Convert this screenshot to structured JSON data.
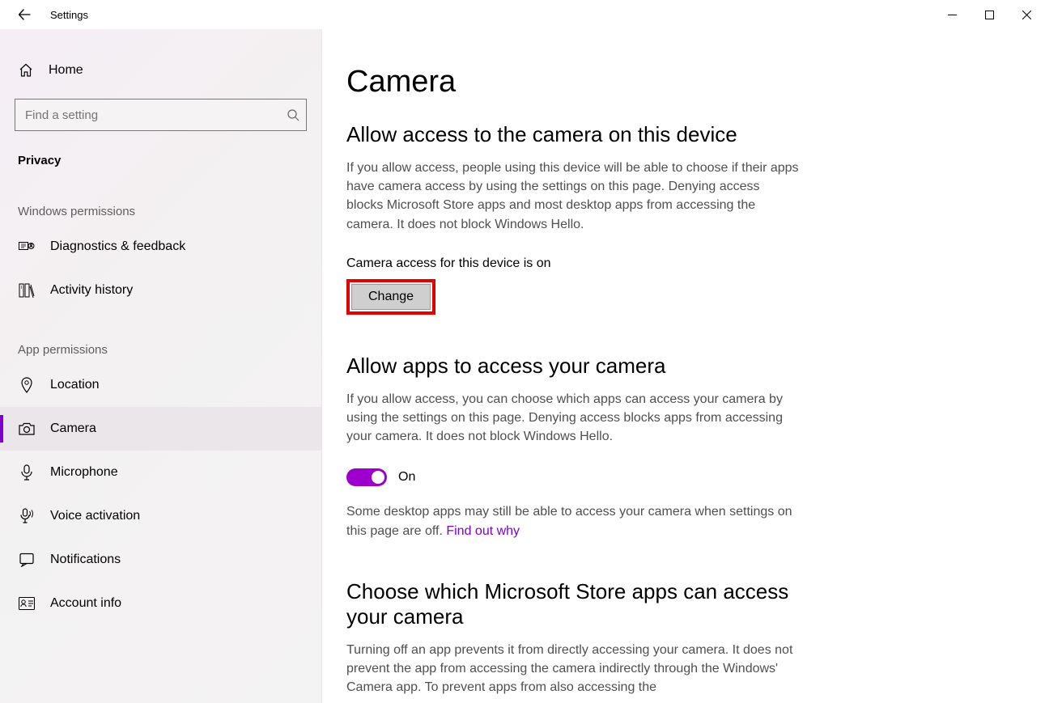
{
  "titlebar": {
    "title": "Settings"
  },
  "sidebar": {
    "home_label": "Home",
    "search_placeholder": "Find a setting",
    "section_label": "Privacy",
    "group_win_perms": "Windows permissions",
    "group_app_perms": "App permissions",
    "items_win": [
      {
        "label": "Diagnostics & feedback"
      },
      {
        "label": "Activity history"
      }
    ],
    "items_app": [
      {
        "label": "Location"
      },
      {
        "label": "Camera"
      },
      {
        "label": "Microphone"
      },
      {
        "label": "Voice activation"
      },
      {
        "label": "Notifications"
      },
      {
        "label": "Account info"
      }
    ]
  },
  "main": {
    "page_title": "Camera",
    "sec1_heading": "Allow access to the camera on this device",
    "sec1_body": "If you allow access, people using this device will be able to choose if their apps have camera access by using the settings on this page. Denying access blocks Microsoft Store apps and most desktop apps from accessing the camera. It does not block Windows Hello.",
    "sec1_status": "Camera access for this device is on",
    "change_label": "Change",
    "sec2_heading": "Allow apps to access your camera",
    "sec2_body": "If you allow access, you can choose which apps can access your camera by using the settings on this page. Denying access blocks apps from accessing your camera. It does not block Windows Hello.",
    "toggle_label": "On",
    "sec2_note_pre": "Some desktop apps may still be able to access your camera when settings on this page are off. ",
    "sec2_note_link": "Find out why",
    "sec3_heading": "Choose which Microsoft Store apps can access your camera",
    "sec3_body": "Turning off an app prevents it from directly accessing your camera. It does not prevent the app from accessing the camera indirectly through the Windows' Camera app. To prevent apps from also accessing the"
  }
}
